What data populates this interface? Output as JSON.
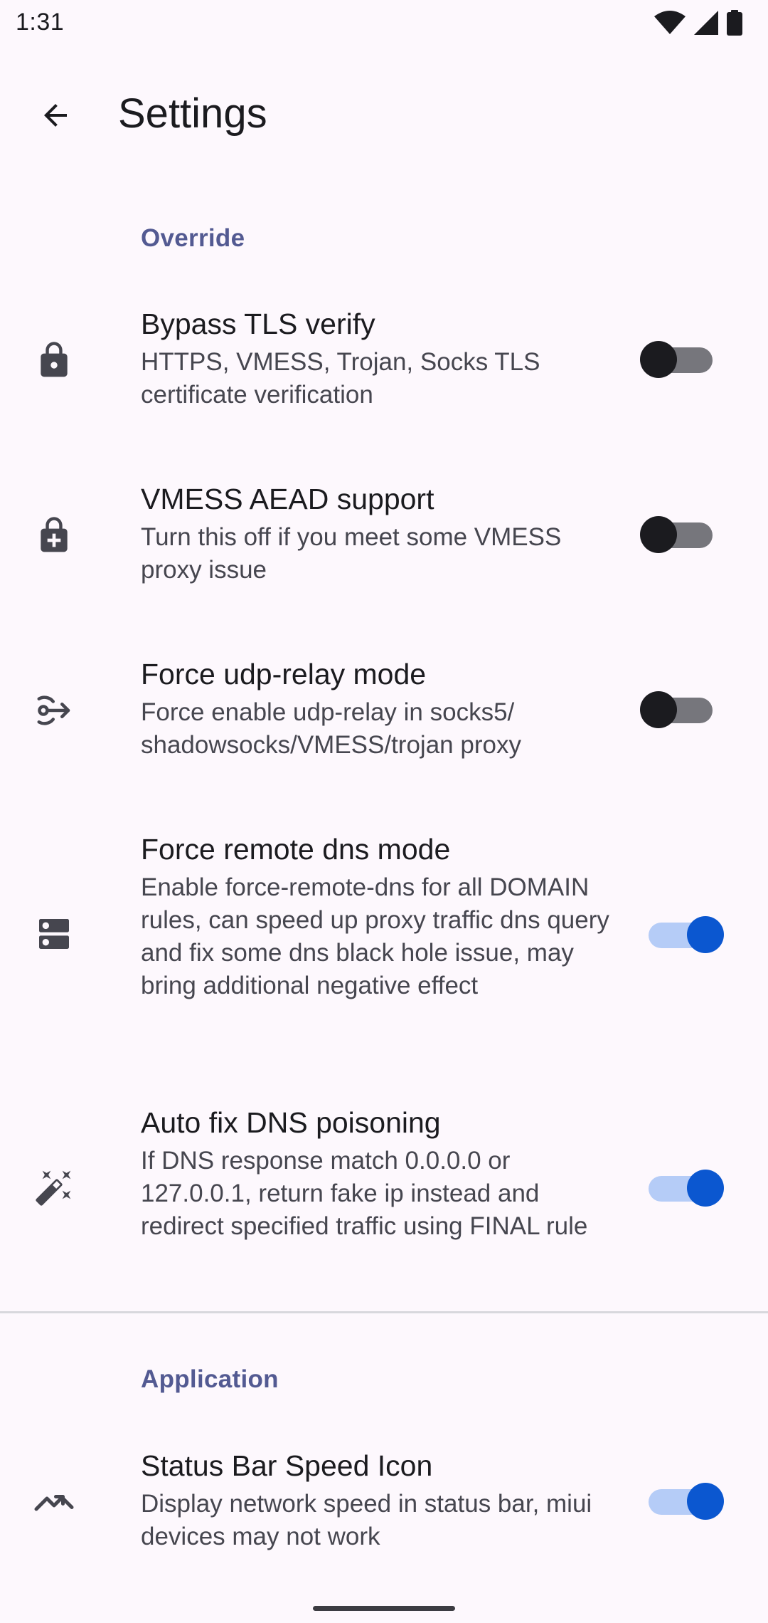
{
  "status_bar": {
    "time": "1:31"
  },
  "top_bar": {
    "title": "Settings"
  },
  "sections": {
    "override": {
      "header": "Override"
    },
    "application": {
      "header": "Application"
    }
  },
  "prefs": [
    {
      "title": "Bypass TLS verify",
      "summary": "HTTPS, VMESS, Trojan, Socks TLS certificate verification",
      "icon": "lock-icon",
      "enabled": false
    },
    {
      "title": "VMESS AEAD support",
      "summary": "Turn this off if you meet some VMESS proxy issue",
      "icon": "lock-plus-icon",
      "enabled": false
    },
    {
      "title": "Force udp-relay mode",
      "summary": "Force enable udp-relay in socks5/ shadowsocks/VMESS/trojan proxy",
      "icon": "relay-icon",
      "enabled": false
    },
    {
      "title": "Force remote dns mode",
      "summary": "Enable force-remote-dns for all DOMAIN rules, can speed up proxy traffic dns query and fix some dns black hole issue, may bring additional negative effect",
      "icon": "dns-icon",
      "enabled": true
    },
    {
      "title": "Auto fix DNS poisoning",
      "summary": "If DNS response match 0.0.0.0 or 127.0.0.1, return fake ip instead and redirect specified traffic using FINAL rule",
      "icon": "magic-wand-icon",
      "enabled": true
    },
    {
      "title": "Status Bar Speed Icon",
      "summary": "Display network speed in status bar, miui devices may not work",
      "icon": "speed-icon",
      "enabled": true
    }
  ],
  "colors": {
    "background": "#fdf8fd",
    "section_header": "#535a92",
    "switch_on_thumb": "#0b57d0",
    "switch_on_track": "#b5ccf7",
    "switch_off_thumb": "#1b1b1f",
    "switch_off_track": "#76767c"
  }
}
